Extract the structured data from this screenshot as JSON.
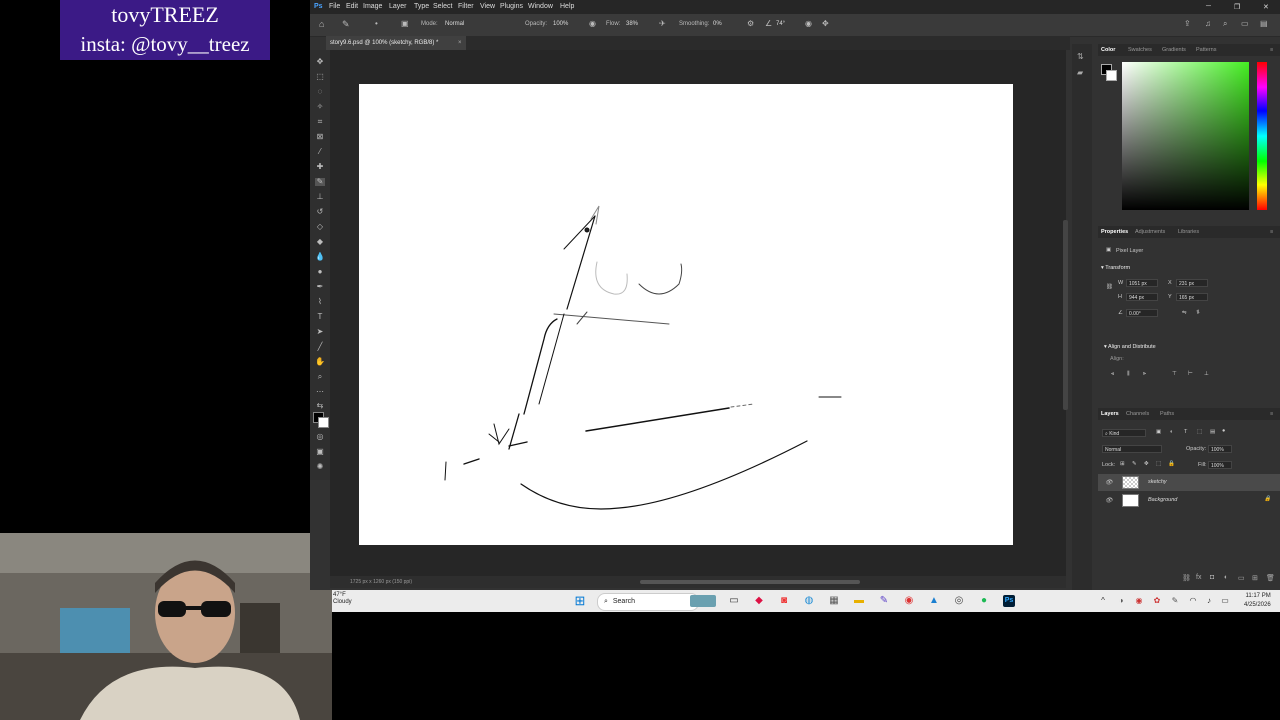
{
  "overlay": {
    "line1": "tovyTREEZ",
    "line2": "insta: @tovy__treez"
  },
  "menu": [
    "File",
    "Edit",
    "Image",
    "Layer",
    "Type",
    "Select",
    "Filter",
    "View",
    "Plugins",
    "Window",
    "Help"
  ],
  "options_bar": {
    "mode_label": "Mode:",
    "mode_value": "Normal",
    "opacity_label": "Opacity:",
    "opacity_value": "100%",
    "flow_label": "Flow:",
    "flow_value": "38%",
    "smoothing_label": "Smoothing:",
    "smoothing_value": "0%",
    "angle_value": "74°"
  },
  "document_tab": "story9.6.psd @ 100% (sketchy, RGB/8) *",
  "status_bar": "1725 px x 1260 px (150 ppi)",
  "panels": {
    "color_tabs": [
      "Color",
      "Swatches",
      "Gradients",
      "Patterns"
    ],
    "properties_tabs": [
      "Properties",
      "Adjustments",
      "Libraries"
    ],
    "pixel_layer": "Pixel Layer",
    "transform_header": "Transform",
    "w_label": "W",
    "w_value": "1051 px",
    "x_label": "X",
    "x_value": "231 px",
    "h_label": "H",
    "h_value": "944 px",
    "y_label": "Y",
    "y_value": "165 px",
    "angle_value": "0.00°",
    "align_header": "Align and Distribute",
    "align_sub": "Align:",
    "layers_tabs": [
      "Layers",
      "Channels",
      "Paths"
    ],
    "kind": "Kind",
    "blend_mode": "Normal",
    "opacity_label": "Opacity:",
    "opacity_value": "100%",
    "lock_label": "Lock:",
    "fill_label": "Fill:",
    "fill_value": "100%",
    "layers": [
      "sketchy",
      "Background"
    ]
  },
  "taskbar": {
    "temperature": "47°F",
    "weather": "Cloudy",
    "search": "Search",
    "time": "11:17 PM",
    "date": "4/25/2026"
  },
  "colors": {
    "overlay_bg": "#3b1a86",
    "ps_bg": "#323232",
    "workarea": "#262626",
    "canvas": "#ffffff"
  }
}
